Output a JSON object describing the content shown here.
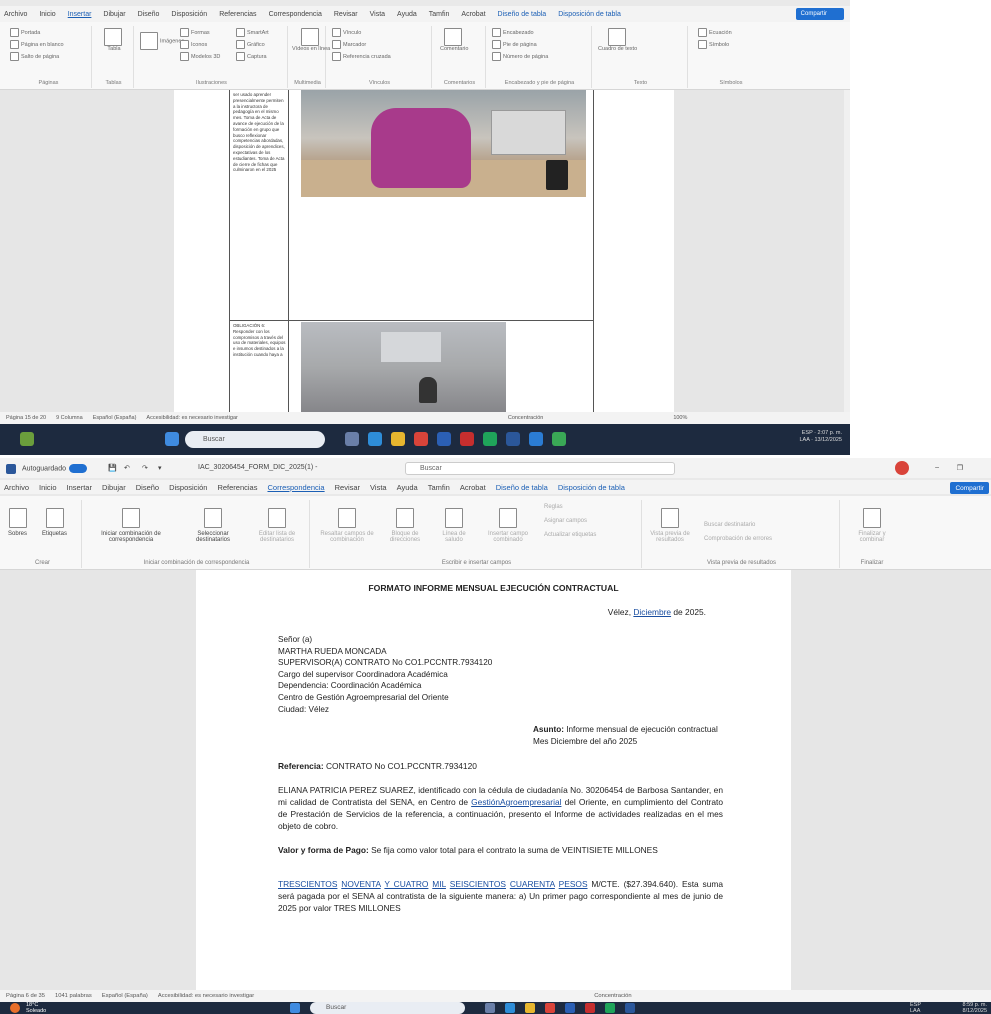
{
  "top": {
    "menu": [
      "Archivo",
      "Inicio",
      "Insertar",
      "Dibujar",
      "Diseño",
      "Disposición",
      "Referencias",
      "Correspondencia",
      "Revisar",
      "Vista",
      "Ayuda",
      "Tamfin",
      "Acrobat"
    ],
    "menu_active": "Insertar",
    "menu_extra": [
      "Diseño de tabla",
      "Disposición de tabla"
    ],
    "share_label": "Compartir",
    "ribbon_groups": [
      {
        "label": "Páginas",
        "items": [
          "Portada",
          "Página en blanco",
          "Salto de página"
        ]
      },
      {
        "label": "Tablas",
        "items": [
          "Tabla"
        ]
      },
      {
        "label": "Ilustraciones",
        "items": [
          "Imágenes",
          "Formas",
          "Iconos",
          "Modelos 3D",
          "SmartArt",
          "Gráfico",
          "Captura"
        ]
      },
      {
        "label": "Multimedia",
        "items": [
          "Vídeos en línea"
        ]
      },
      {
        "label": "Vínculos",
        "items": [
          "Vínculo",
          "Marcador",
          "Referencia cruzada"
        ]
      },
      {
        "label": "Comentarios",
        "items": [
          "Comentario"
        ]
      },
      {
        "label": "Encabezado y pie de página",
        "items": [
          "Encabezado",
          "Pie de página",
          "Número de página"
        ]
      },
      {
        "label": "Texto",
        "items": [
          "Cuadro de texto"
        ]
      },
      {
        "label": "Símbolos",
        "items": [
          "Ecuación",
          "Símbolo"
        ]
      }
    ],
    "table_cell_text": "ser usado aprender presencialmente permiten a la instructora de pedagogía en el mismo mes. Toma de Acta de avance de ejecución de la formación en grupo que busco reflexionar competencias abordadas, disposición de aprendices, expectativas de los estudiantes. Toma de Acta de cierre de fichas que culminaron en el 2025",
    "table_cell_text2": "OBLIGACIÓN 6: Responder con los compromisos a través del uso de materiales, equipos e insumos destinados a la institución cuando haya a",
    "status": [
      "Página 15 de 20",
      "9 Columna",
      "Español (España)",
      "Accesibilidad: es necesario investigar"
    ],
    "status_right": "Concentración",
    "zoom": "100%",
    "search_placeholder": "Buscar",
    "clock": [
      "2:07 p. m.",
      "13/12/2025"
    ],
    "lang": [
      "ESP",
      "LAA"
    ]
  },
  "bottom": {
    "autosave_label": "Autoguardado",
    "filename": "IAC_30206454_FORM_DIC_2025(1) -",
    "search_placeholder": "Buscar",
    "menu": [
      "Archivo",
      "Inicio",
      "Insertar",
      "Dibujar",
      "Diseño",
      "Disposición",
      "Referencias",
      "Correspondencia",
      "Revisar",
      "Vista",
      "Ayuda",
      "Tamfin",
      "Acrobat"
    ],
    "menu_active": "Correspondencia",
    "menu_extra": [
      "Diseño de tabla",
      "Disposición de tabla"
    ],
    "share_label": "Compartir",
    "ribbon": {
      "crear": {
        "label": "Crear",
        "buttons": [
          "Sobres",
          "Etiquetas"
        ]
      },
      "iniciar": {
        "label": "Iniciar combinación de correspondencia",
        "buttons": [
          "Iniciar combinación de correspondencia",
          "Seleccionar destinatarios",
          "Editar lista de destinatarios"
        ]
      },
      "escribir": {
        "label": "Escribir e insertar campos",
        "buttons": [
          "Resaltar campos de combinación",
          "Bloque de direcciones",
          "Línea de saludo",
          "Insertar campo combinado",
          "Reglas",
          "Asignar campos",
          "Actualizar etiquetas"
        ]
      },
      "vista": {
        "label": "Vista previa de resultados",
        "buttons": [
          "Vista previa de resultados",
          "Buscar destinatario",
          "Comprobación de errores"
        ]
      },
      "finalizar": {
        "label": "Finalizar",
        "buttons": [
          "Finalizar y combinar"
        ]
      }
    },
    "doc": {
      "title": "FORMATO INFORME MENSUAL EJECUCIÓN CONTRACTUAL",
      "city_prefix": "Vélez, ",
      "city_month": "Diciembre",
      "city_suffix": " de 2025.",
      "address": [
        "Señor (a)",
        "MARTHA RUEDA MONCADA",
        "SUPERVISOR(A) CONTRATO No CO1.PCCNTR.7934120",
        "Cargo del supervisor Coordinadora Académica",
        "Dependencia: Coordinación Académica",
        "Centro de Gestión Agroempresarial del Oriente",
        "Ciudad: Vélez"
      ],
      "subject_label": "Asunto:",
      "subject_text": " Informe mensual de ejecución contractual Mes Diciembre del año 2025",
      "ref_label": "Referencia:",
      "ref_text": " CONTRATO No CO1.PCCNTR.7934120",
      "para_a": "ELIANA PATRICIA PEREZ SUAREZ, identificado con la cédula de ciudadanía No. 30206454 de Barbosa Santander, en mi calidad de Contratista del SENA, en Centro de ",
      "para_link": "GestiónAgroempresarial",
      "para_b": " del Oriente, en cumplimiento del Contrato de Prestación de Servicios de la referencia, a continuación, presento el Informe de actividades realizadas en el mes objeto de cobro.",
      "pay_label": "Valor y forma de Pago:",
      "pay_text": " Se fija como valor total para el contrato la suma de VEINTISIETE MILLONES",
      "amt_words": [
        "TRESCIENTOS",
        "NOVENTA",
        "Y CUATRO",
        "MIL",
        "SEISCIENTOS",
        "CUARENTA",
        "PESOS"
      ],
      "amt_text": " M/CTE. ($27.394.640). Esta suma será pagada por el SENA al contratista de la siguiente manera: a) Un primer pago correspondiente al mes de junio de 2025 por valor TRES MILLONES"
    },
    "status": [
      "Página 6 de 35",
      "1041 palabras",
      "Español (España)",
      "Accesibilidad: es necesario investigar"
    ],
    "status_right": "Concentración",
    "weather": [
      "18°C",
      "Soleado"
    ],
    "clock": [
      "8:59 p. m.",
      "8/12/2025"
    ],
    "lang": [
      "ESP",
      "LAA"
    ]
  },
  "colors": {
    "accent": "#1f6fd1",
    "taskbar": "#1d2a3f",
    "link": "#1a4ea0"
  }
}
